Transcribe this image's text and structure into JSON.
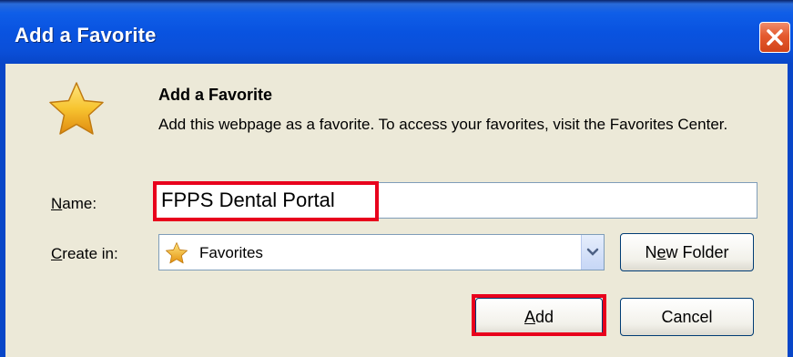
{
  "window": {
    "title": "Add a Favorite",
    "close_icon": "close-icon"
  },
  "header": {
    "icon": "star-icon",
    "heading": "Add a Favorite",
    "description": "Add this webpage as a favorite. To access your favorites, visit the Favorites Center."
  },
  "form": {
    "name_label_prefix": "N",
    "name_label_rest": "ame:",
    "name_value": "FPPS Dental Portal",
    "create_label_prefix": "C",
    "create_label_rest": "reate in:",
    "create_in_value": "Favorites",
    "create_in_icon": "star-icon",
    "dropdown_icon": "chevron-down-icon"
  },
  "buttons": {
    "new_folder_prefix": "N",
    "new_folder_underlined": "e",
    "new_folder_rest": "w Folder",
    "add_underlined": "A",
    "add_rest": "dd",
    "cancel": "Cancel"
  },
  "highlight_color": "#e8001c"
}
